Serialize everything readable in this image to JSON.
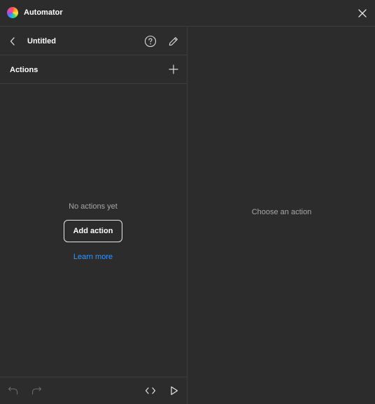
{
  "window": {
    "app_title": "Automator",
    "logo_icon": "automator-logo-icon"
  },
  "panel_header": {
    "title": "Untitled",
    "back_icon": "chevron-left-icon",
    "help_icon": "help-circle-icon",
    "edit_icon": "pencil-icon"
  },
  "actions_section": {
    "title": "Actions",
    "add_icon": "plus-icon"
  },
  "empty_state": {
    "message": "No actions yet",
    "button_label": "Add action",
    "link_label": "Learn more"
  },
  "footer": {
    "undo_icon": "undo-icon",
    "redo_icon": "redo-icon",
    "code_icon": "code-icon",
    "run_icon": "play-icon"
  },
  "right_panel": {
    "placeholder": "Choose an action"
  },
  "colors": {
    "background": "#2c2c2c",
    "divider": "#3d3d3d",
    "link": "#3b95f0",
    "muted_text": "#a6a6a6"
  }
}
